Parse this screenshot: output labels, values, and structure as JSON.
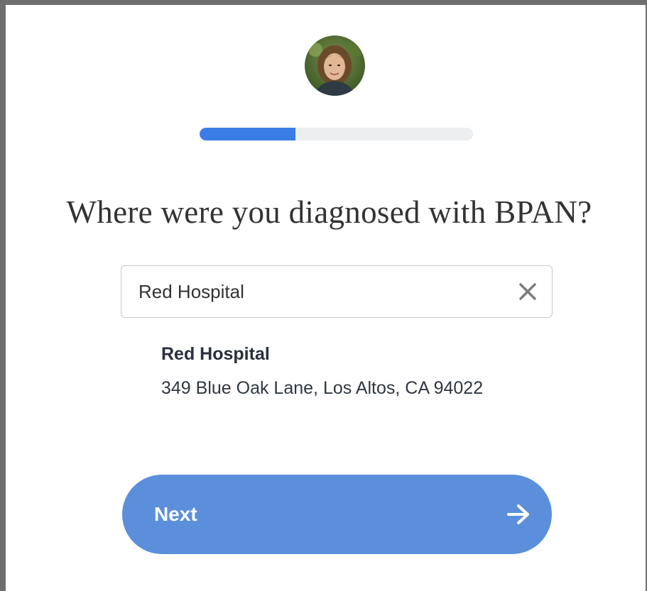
{
  "question": "Where were you diagnosed with BPAN?",
  "progress": {
    "fraction": 0.35,
    "fill_color": "#3a7de6",
    "track_color": "#eceef0"
  },
  "avatar": {
    "icon": "user-avatar-photo"
  },
  "search": {
    "value": "Red Hospital",
    "clear_icon": "close-icon"
  },
  "result": {
    "name": "Red Hospital",
    "address": "349 Blue Oak Lane, Los Altos, CA 94022"
  },
  "next_button": {
    "label": "Next",
    "icon": "arrow-right-icon",
    "color": "#5b8fdb"
  }
}
